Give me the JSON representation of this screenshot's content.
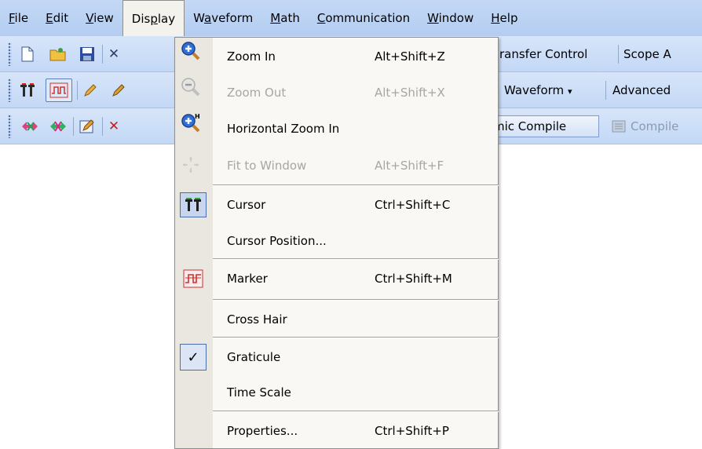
{
  "menubar": {
    "items": [
      {
        "label": "File",
        "mnemonic": "F",
        "rest": "ile"
      },
      {
        "label": "Edit",
        "mnemonic": "E",
        "rest": "dit"
      },
      {
        "label": "View",
        "mnemonic": "V",
        "rest": "iew"
      },
      {
        "label": "Display",
        "pre": "Dis",
        "mnemonic": "p",
        "rest": "lay"
      },
      {
        "label": "Waveform",
        "pre": "W",
        "mnemonic": "a",
        "rest": "veform"
      },
      {
        "label": "Math",
        "mnemonic": "M",
        "rest": "ath"
      },
      {
        "label": "Communication",
        "mnemonic": "C",
        "rest": "ommunication"
      },
      {
        "label": "Window",
        "mnemonic": "W",
        "rest": "indow"
      },
      {
        "label": "Help",
        "mnemonic": "H",
        "rest": "elp"
      }
    ]
  },
  "toolbar1": {
    "transfer_control": "ransfer  Control",
    "scope": "Scope A"
  },
  "toolbar2": {
    "waveform": "Waveform",
    "advanced": "Advanced"
  },
  "toolbar3": {
    "compile": "mic Compile",
    "compile2": "Compile"
  },
  "dropdown": {
    "zoom_in": {
      "label": "Zoom In",
      "shortcut": "Alt+Shift+Z"
    },
    "zoom_out": {
      "label": "Zoom Out",
      "shortcut": "Alt+Shift+X"
    },
    "horizontal_zoom_in": {
      "label": "Horizontal Zoom In"
    },
    "fit_to_window": {
      "label": "Fit to Window",
      "shortcut": "Alt+Shift+F"
    },
    "cursor": {
      "label": "Cursor",
      "shortcut": "Ctrl+Shift+C"
    },
    "cursor_position": {
      "label": "Cursor Position..."
    },
    "marker": {
      "label": "Marker",
      "shortcut": "Ctrl+Shift+M"
    },
    "cross_hair": {
      "label": "Cross Hair"
    },
    "graticule": {
      "label": "Graticule",
      "checked": true
    },
    "time_scale": {
      "label": "Time Scale"
    },
    "properties": {
      "label": "Properties...",
      "shortcut": "Ctrl+Shift+P"
    }
  },
  "icons": {
    "zoom_in": "zoom-in-icon",
    "zoom_out": "zoom-out-icon",
    "horizontal_zoom": "horizontal-zoom-icon",
    "fit": "fit-to-window-icon",
    "cursor": "cursor-icon",
    "marker": "marker-icon",
    "check": "check-icon"
  },
  "colors": {
    "menubar": "#c4d8f5",
    "accent": "#4b6ea8",
    "dropdown_bg": "#f9f8f4"
  }
}
